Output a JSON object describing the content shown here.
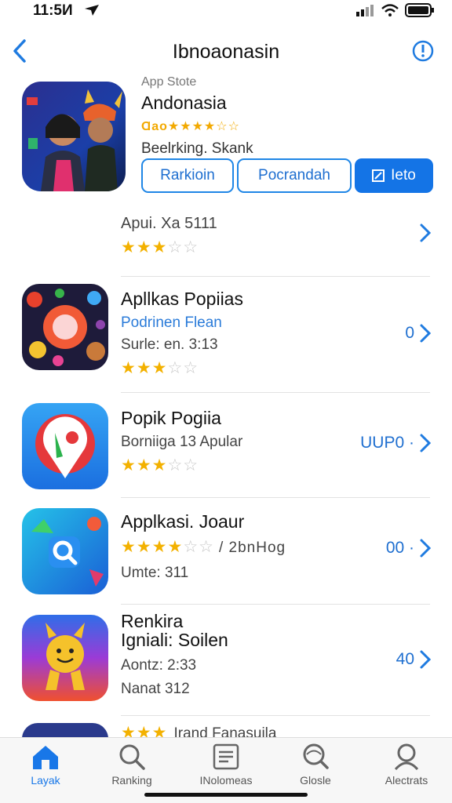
{
  "status": {
    "time": "11:5И"
  },
  "nav": {
    "title": "Ibnoaonasin"
  },
  "featured": {
    "store_label": "App Stote",
    "name": "Andonasia",
    "rating_text": "Ɑao★★★★☆☆",
    "subtitle": "Beelrking. Skank",
    "buttons": [
      "Rarkioin",
      "Pocrandah",
      "Ieto"
    ]
  },
  "list": [
    {
      "lines": [
        "Apui. Xa 5111"
      ],
      "rating": 3
    },
    {
      "name": "Apllkas Popiias",
      "subtitle": "Podrinen Flean",
      "meta": "Surle: en. 3:13",
      "rating": 3,
      "action": "0"
    },
    {
      "name": "Popik Pogiia",
      "meta": "Borniiga 13 Apular",
      "rating": 3,
      "action": "UUP0 ·"
    },
    {
      "name": "Applkasi. Joaur",
      "rating": 3.5,
      "rating_suffix": "/ 2bnHog",
      "meta": "Umte: 311",
      "action": "00 ·"
    },
    {
      "name": "Renkira",
      "subtitle": "Igniali: Soilen",
      "meta": "Aontz: 2:33",
      "meta2": "Nanat 312",
      "action": "40"
    },
    {
      "name": "Irand Fanasuila",
      "rating": 3
    }
  ],
  "tabs": [
    "Layak",
    "Ranking",
    "INolomeas",
    "Glosle",
    "Alectrats"
  ],
  "colors": {
    "accent": "#1474e6",
    "star": "#f3b100"
  }
}
